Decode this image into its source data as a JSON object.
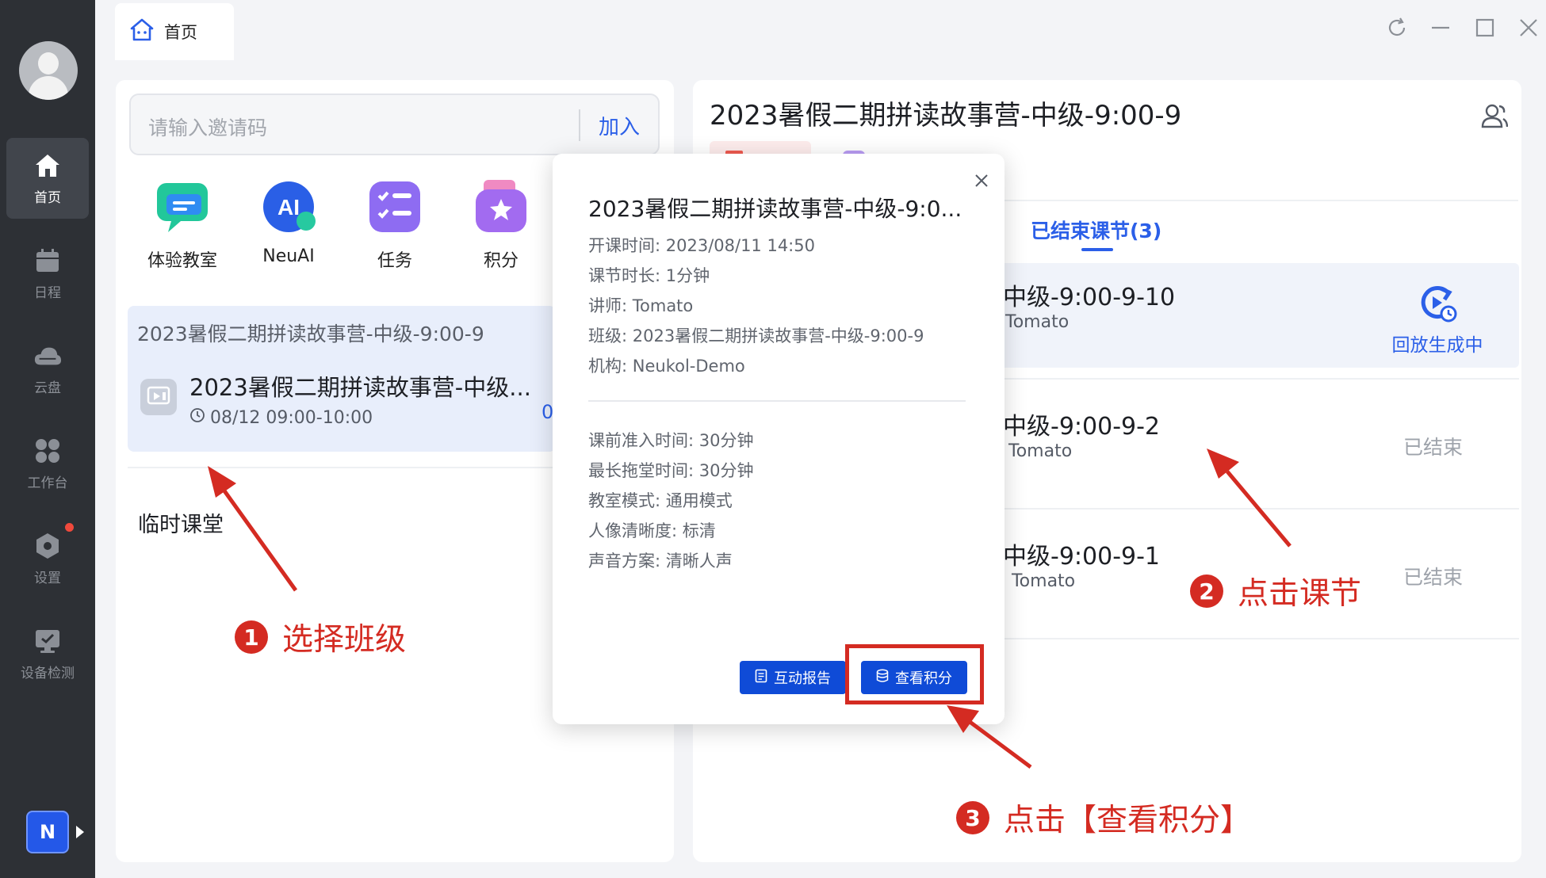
{
  "sidebar": {
    "items": [
      {
        "label": "首页",
        "icon": "home-icon"
      },
      {
        "label": "日程",
        "icon": "calendar-icon"
      },
      {
        "label": "云盘",
        "icon": "cloud-icon"
      },
      {
        "label": "工作台",
        "icon": "workbench-icon"
      },
      {
        "label": "设置",
        "icon": "settings-icon"
      },
      {
        "label": "设备检测",
        "icon": "device-check-icon"
      }
    ],
    "org_badge": "N"
  },
  "tab": {
    "title": "首页"
  },
  "invite": {
    "placeholder": "请输入邀请码",
    "join_label": "加入"
  },
  "quick_actions": [
    {
      "label": "体验教室",
      "icon": "classroom-icon"
    },
    {
      "label": "NeuAI",
      "icon": "ai-icon"
    },
    {
      "label": "任务",
      "icon": "task-icon"
    },
    {
      "label": "积分",
      "icon": "points-icon"
    }
  ],
  "class_card": {
    "class_name": "2023暑假二期拼读故事营-中级-9:00-9",
    "lesson_title": "2023暑假二期拼读故事营-中级...",
    "time": "08/12 09:00-10:00",
    "overflow_char": "0"
  },
  "temp_section": {
    "title": "临时课堂"
  },
  "right_panel": {
    "title": "2023暑假二期拼读故事营-中级-9:00-9",
    "ended_tab": "已结束课节(3)",
    "lessons": [
      {
        "name": "中级-9:00-9-10",
        "teacher": "Tomato",
        "status": "回放生成中"
      },
      {
        "name": "中级-9:00-9-2",
        "teacher": "Tomato",
        "status": "已结束"
      },
      {
        "name": "中级-9:00-9-1",
        "teacher": ", Tomato",
        "status": "已结束"
      }
    ]
  },
  "modal": {
    "title": "2023暑假二期拼读故事营-中级-9:0...",
    "details": [
      "开课时间: 2023/08/11 14:50",
      "课节时长: 1分钟",
      "讲师: Tomato",
      "班级: 2023暑假二期拼读故事营-中级-9:00-9",
      "机构: Neukol-Demo"
    ],
    "settings": [
      "课前准入时间: 30分钟",
      "最长拖堂时间: 30分钟",
      "教室模式: 通用模式",
      "人像清晰度: 标清",
      "声音方案: 清晰人声"
    ],
    "report_button": "互动报告",
    "points_button": "查看积分"
  },
  "annotations": [
    {
      "number": "1",
      "text": "选择班级"
    },
    {
      "number": "2",
      "text": "点击课节"
    },
    {
      "number": "3",
      "text": "点击【查看积分】"
    }
  ],
  "colors": {
    "accent": "#2b5fe8",
    "sidebar": "#2d3035",
    "annotation": "#d42b22",
    "button": "#0f4bd7"
  }
}
